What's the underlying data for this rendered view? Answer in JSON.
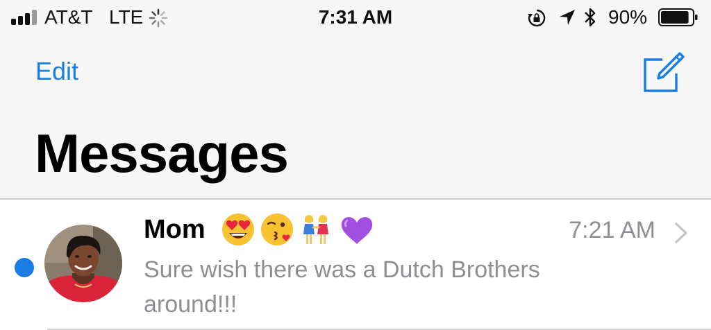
{
  "status_bar": {
    "carrier": "AT&T",
    "network": "LTE",
    "time": "7:31 AM",
    "battery_percent_text": "90%",
    "battery_level": 0.9,
    "signal_bars_filled": 3,
    "signal_bars_total": 4,
    "icons": [
      "signal-icon",
      "activity-spinner-icon",
      "rotation-lock-icon",
      "location-arrow-icon",
      "bluetooth-icon",
      "battery-icon"
    ]
  },
  "nav": {
    "edit_label": "Edit",
    "compose_icon": "compose-icon",
    "title": "Messages"
  },
  "conversations": [
    {
      "name": "Mom",
      "emojis": [
        "heart-eyes-face",
        "face-blowing-kiss",
        "two-women-holding-hands",
        "purple-heart"
      ],
      "time": "7:21 AM",
      "preview": "Sure wish there was a Dutch Brothers around!!!",
      "unread": true
    }
  ],
  "colors": {
    "accent": "#1a7de4",
    "secondary_text": "#8e8e93",
    "header_background": "#f7f7f7",
    "list_background": "#ffffff",
    "purple_heart": "#a14fe0"
  }
}
